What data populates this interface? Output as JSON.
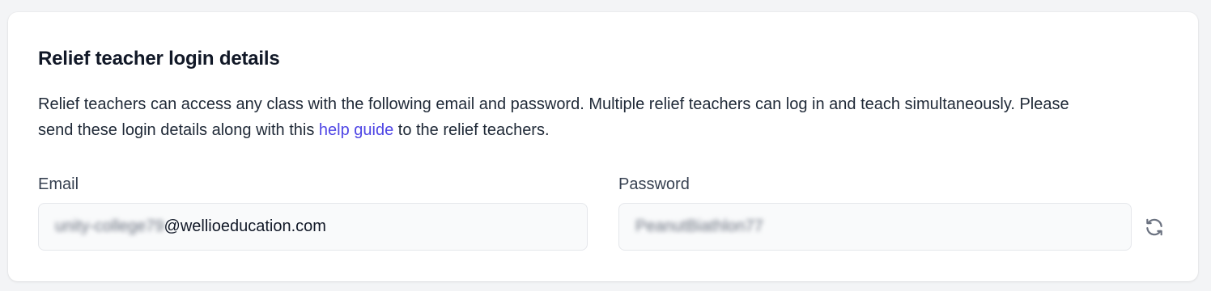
{
  "card": {
    "title": "Relief teacher login details",
    "description_before_link": "Relief teachers can access any class with the following email and password. Multiple relief teachers can log in and teach simultaneously. Please send these login details along with this ",
    "help_link_label": "help guide",
    "description_after_link": " to the relief teachers."
  },
  "email": {
    "label": "Email",
    "value_prefix_obscured": "unity-college79",
    "value_domain": "@wellioeducation.com"
  },
  "password": {
    "label": "Password",
    "value_obscured": "PeanutBiathlon77",
    "refresh_icon": "refresh-icon"
  },
  "colors": {
    "link": "#4f46e5",
    "background": "#f3f4f6",
    "card": "#ffffff",
    "input_bg": "#f9fafb",
    "icon": "#6b7280"
  }
}
